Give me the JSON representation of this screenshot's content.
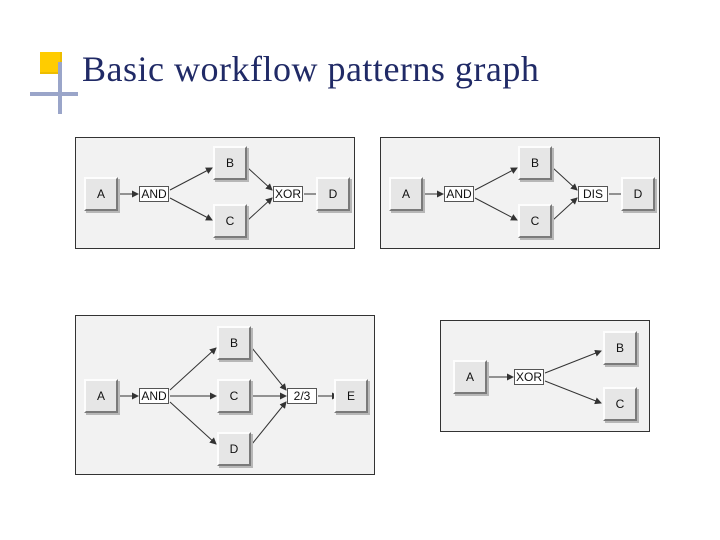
{
  "title": "Basic workflow patterns graph",
  "panels": {
    "p1": {
      "nodes": {
        "A": "A",
        "B": "B",
        "C": "C",
        "D": "D"
      },
      "ops": {
        "and": "AND",
        "xor": "XOR"
      }
    },
    "p2": {
      "nodes": {
        "A": "A",
        "B": "B",
        "C": "C",
        "D": "D"
      },
      "ops": {
        "and": "AND",
        "dis": "DIS"
      }
    },
    "p3": {
      "nodes": {
        "A": "A",
        "B": "B",
        "C": "C",
        "D": "D",
        "E": "E"
      },
      "ops": {
        "and": "AND",
        "mn": "2/3"
      }
    },
    "p4": {
      "nodes": {
        "A": "A",
        "B": "B",
        "C": "C"
      },
      "ops": {
        "xor": "XOR"
      }
    }
  }
}
